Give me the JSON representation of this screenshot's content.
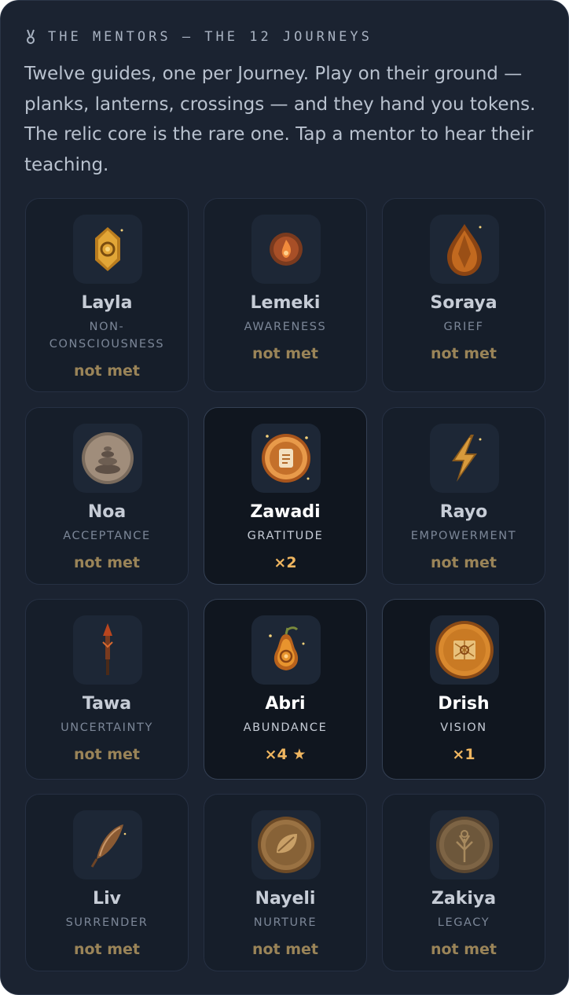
{
  "header": {
    "medal_icon": "medal-icon",
    "title": "THE MENTORS — THE 12 JOURNEYS"
  },
  "intro": "Twelve guides, one per Journey. Play on their ground — planks, lanterns, crossings — and they hand you tokens. The relic core is the rare one. Tap a mentor to hear their teaching.",
  "colors": {
    "panel": "#1b2331",
    "accent": "#f0b660",
    "muted_gold": "#9a8458"
  },
  "mentors": [
    {
      "name": "Layla",
      "theme": "NON-CONSCIOUSNESS",
      "status": "not met",
      "met": false,
      "icon": "amber-crystal-icon"
    },
    {
      "name": "Lemeki",
      "theme": "AWARENESS",
      "status": "not met",
      "met": false,
      "icon": "ember-orb-icon"
    },
    {
      "name": "Soraya",
      "theme": "GRIEF",
      "status": "not met",
      "met": false,
      "icon": "teardrop-gem-icon"
    },
    {
      "name": "Noa",
      "theme": "ACCEPTANCE",
      "status": "not met",
      "met": false,
      "icon": "stacked-stones-icon"
    },
    {
      "name": "Zawadi",
      "theme": "GRATITUDE",
      "status": "×2",
      "met": true,
      "icon": "scroll-medallion-icon"
    },
    {
      "name": "Rayo",
      "theme": "EMPOWERMENT",
      "status": "not met",
      "met": false,
      "icon": "lightning-bolt-icon"
    },
    {
      "name": "Tawa",
      "theme": "UNCERTAINTY",
      "status": "not met",
      "met": false,
      "icon": "arrow-spear-icon"
    },
    {
      "name": "Abri",
      "theme": "ABUNDANCE",
      "status": "×4 ★",
      "met": true,
      "icon": "golden-pear-icon"
    },
    {
      "name": "Drish",
      "theme": "VISION",
      "status": "×1",
      "met": true,
      "icon": "map-coin-icon"
    },
    {
      "name": "Liv",
      "theme": "SURRENDER",
      "status": "not met",
      "met": false,
      "icon": "feather-icon"
    },
    {
      "name": "Nayeli",
      "theme": "NURTURE",
      "status": "not met",
      "met": false,
      "icon": "seed-coin-icon"
    },
    {
      "name": "Zakiya",
      "theme": "LEGACY",
      "status": "not met",
      "met": false,
      "icon": "tree-coin-icon"
    }
  ]
}
